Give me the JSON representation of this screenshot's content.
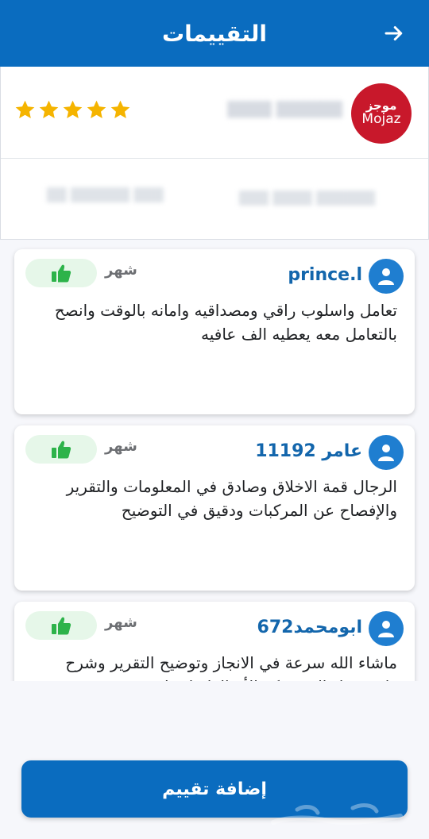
{
  "header": {
    "title": "التقييمات",
    "back_icon": "arrow-right-icon"
  },
  "provider": {
    "logo": {
      "line1": "موجز",
      "line2": "Mojaz",
      "color": "#c8182b"
    },
    "name": "",
    "rating": 5
  },
  "reviews": [
    {
      "name": "prince.l",
      "time": "شهر",
      "text": "تعامل واسلوب راقي ومصداقيه وامانه بالوقت وانصح بالتعامل معه يعطيه الف عافيه"
    },
    {
      "name": "عامر  11192",
      "time": "شهر",
      "text": "الرجال قمة الاخلاق وصادق في المعلومات والتقرير والإفصاح عن المركبات ودقيق في التوضيح"
    },
    {
      "name": "ابومحمد672",
      "time": "شهر",
      "text": "ماشاء الله سرعة في الانجاز وتوضيح التقرير وشرح واضح نقل الي تشكر الأخ الفاضل واتمنى"
    }
  ],
  "add_review_button": "إضافة تقييم",
  "colors": {
    "primary": "#0a6cbf",
    "star": "#f5b400",
    "like_bg": "#e6f7e9",
    "like_icon": "#2db34a"
  }
}
